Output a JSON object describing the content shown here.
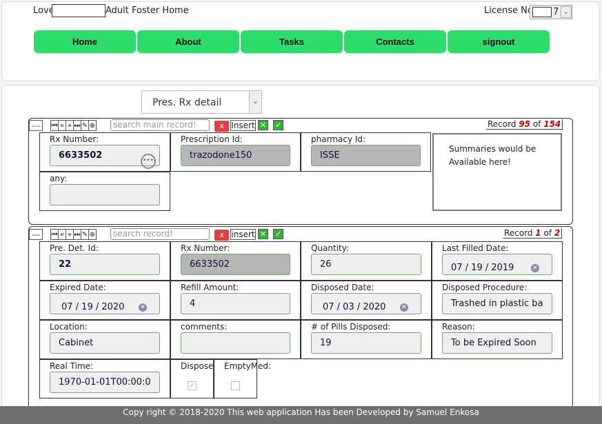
{
  "header": {
    "title_prefix": "Love",
    "title_suffix": "Adult Foster Home",
    "license_label": "License No.",
    "license_value": "7"
  },
  "nav": {
    "home": "Home",
    "about": "About",
    "tasks": "Tasks",
    "contacts": "Contacts",
    "signout": "signout"
  },
  "view_select": "Pres. Rx detail",
  "main_toolbar": {
    "collapse": "---",
    "nav_icons": [
      "⏮",
      "«",
      "»",
      "⏭",
      "✎",
      "⊕"
    ],
    "search_placeholder": "search main record!",
    "delete": "x",
    "insert": "Insert",
    "record_label": "Record",
    "record_current": "95",
    "record_of": "of",
    "record_total": "154"
  },
  "main_record": {
    "rx_number_label": "Rx Number:",
    "rx_number": "6633502",
    "prescription_id_label": "Prescription Id:",
    "prescription_id": "trazodone150",
    "pharmacy_id_label": "pharmacy Id:",
    "pharmacy_id": "ISSE",
    "any_label": "any:",
    "any": "",
    "summary": "Summaries would be Available here!"
  },
  "detail_toolbar": {
    "collapse": "---",
    "nav_icons": [
      "⏮",
      "«",
      "»",
      "⏭",
      "✎",
      "⊕"
    ],
    "search_placeholder": "search record!",
    "delete": "x",
    "insert": "insert",
    "record_label": "Record",
    "record_current": "1",
    "record_of": "of",
    "record_total": "2"
  },
  "detail": {
    "pre_det_id_label": "Pre. Det. Id:",
    "pre_det_id": "22",
    "rx_number_label": "Rx Number:",
    "rx_number": "6633502",
    "quantity_label": "Quantity:",
    "quantity": "26",
    "last_filled_label": "Last Filled Date:",
    "last_filled": "07 / 19 / 2019",
    "expired_label": "Expired Date:",
    "expired": "07 / 19 / 2020",
    "refill_label": "Refill Amount:",
    "refill": "4",
    "disposed_date_label": "Disposed Date:",
    "disposed_date": "07 / 03 / 2020",
    "disposed_proc_label": "Disposed Procedure:",
    "disposed_proc": "Trashed in plastic ba",
    "location_label": "Location:",
    "location": "Cabinet",
    "comments_label": "comments:",
    "comments": "",
    "pills_label": "# of Pills Disposed:",
    "pills": "19",
    "reason_label": "Reason:",
    "reason": "To be Expired Soon",
    "real_time_label": "Real Time:",
    "real_time": "1970-01-01T00:00:0",
    "disposed_label": "Disposed:",
    "disposed_checked": true,
    "empty_label": "EmptyMed:",
    "empty_checked": false
  },
  "footer": "Copy right © 2018-2020 This web application Has been Developed by Samuel Enkosa",
  "colors": {
    "nav_green": "#2edc6b",
    "footer_bg": "#707070",
    "accent_red": "#c00000"
  }
}
